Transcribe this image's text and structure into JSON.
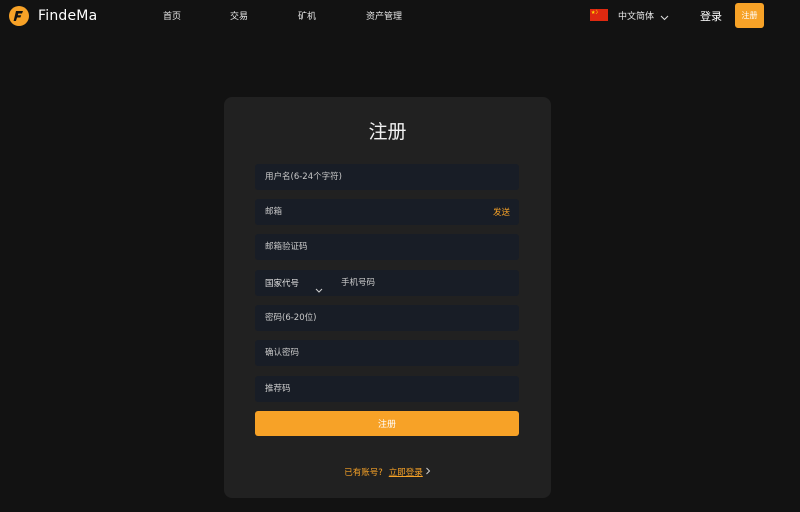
{
  "brand": {
    "name": "FindeMa",
    "accent": "#f7a227"
  },
  "nav": {
    "items": [
      {
        "label": "首页"
      },
      {
        "label": "交易"
      },
      {
        "label": "矿机"
      },
      {
        "label": "资产管理"
      }
    ],
    "language": {
      "label": "中文简体",
      "flag_icon": "china-flag-icon"
    },
    "login_label": "登录",
    "signup_label": "注册"
  },
  "form": {
    "title": "注册",
    "username_placeholder": "用户名(6-24个字符)",
    "email_placeholder": "邮箱",
    "send_label": "发送",
    "email_code_placeholder": "邮箱验证码",
    "country_code_label": "国家代号",
    "phone_placeholder": "手机号码",
    "password_placeholder": "密码(6-20位)",
    "confirm_password_placeholder": "确认密码",
    "referral_placeholder": "推荐码",
    "submit_label": "注册",
    "has_account_text": "已有账号?",
    "login_now_label": "立即登录"
  }
}
